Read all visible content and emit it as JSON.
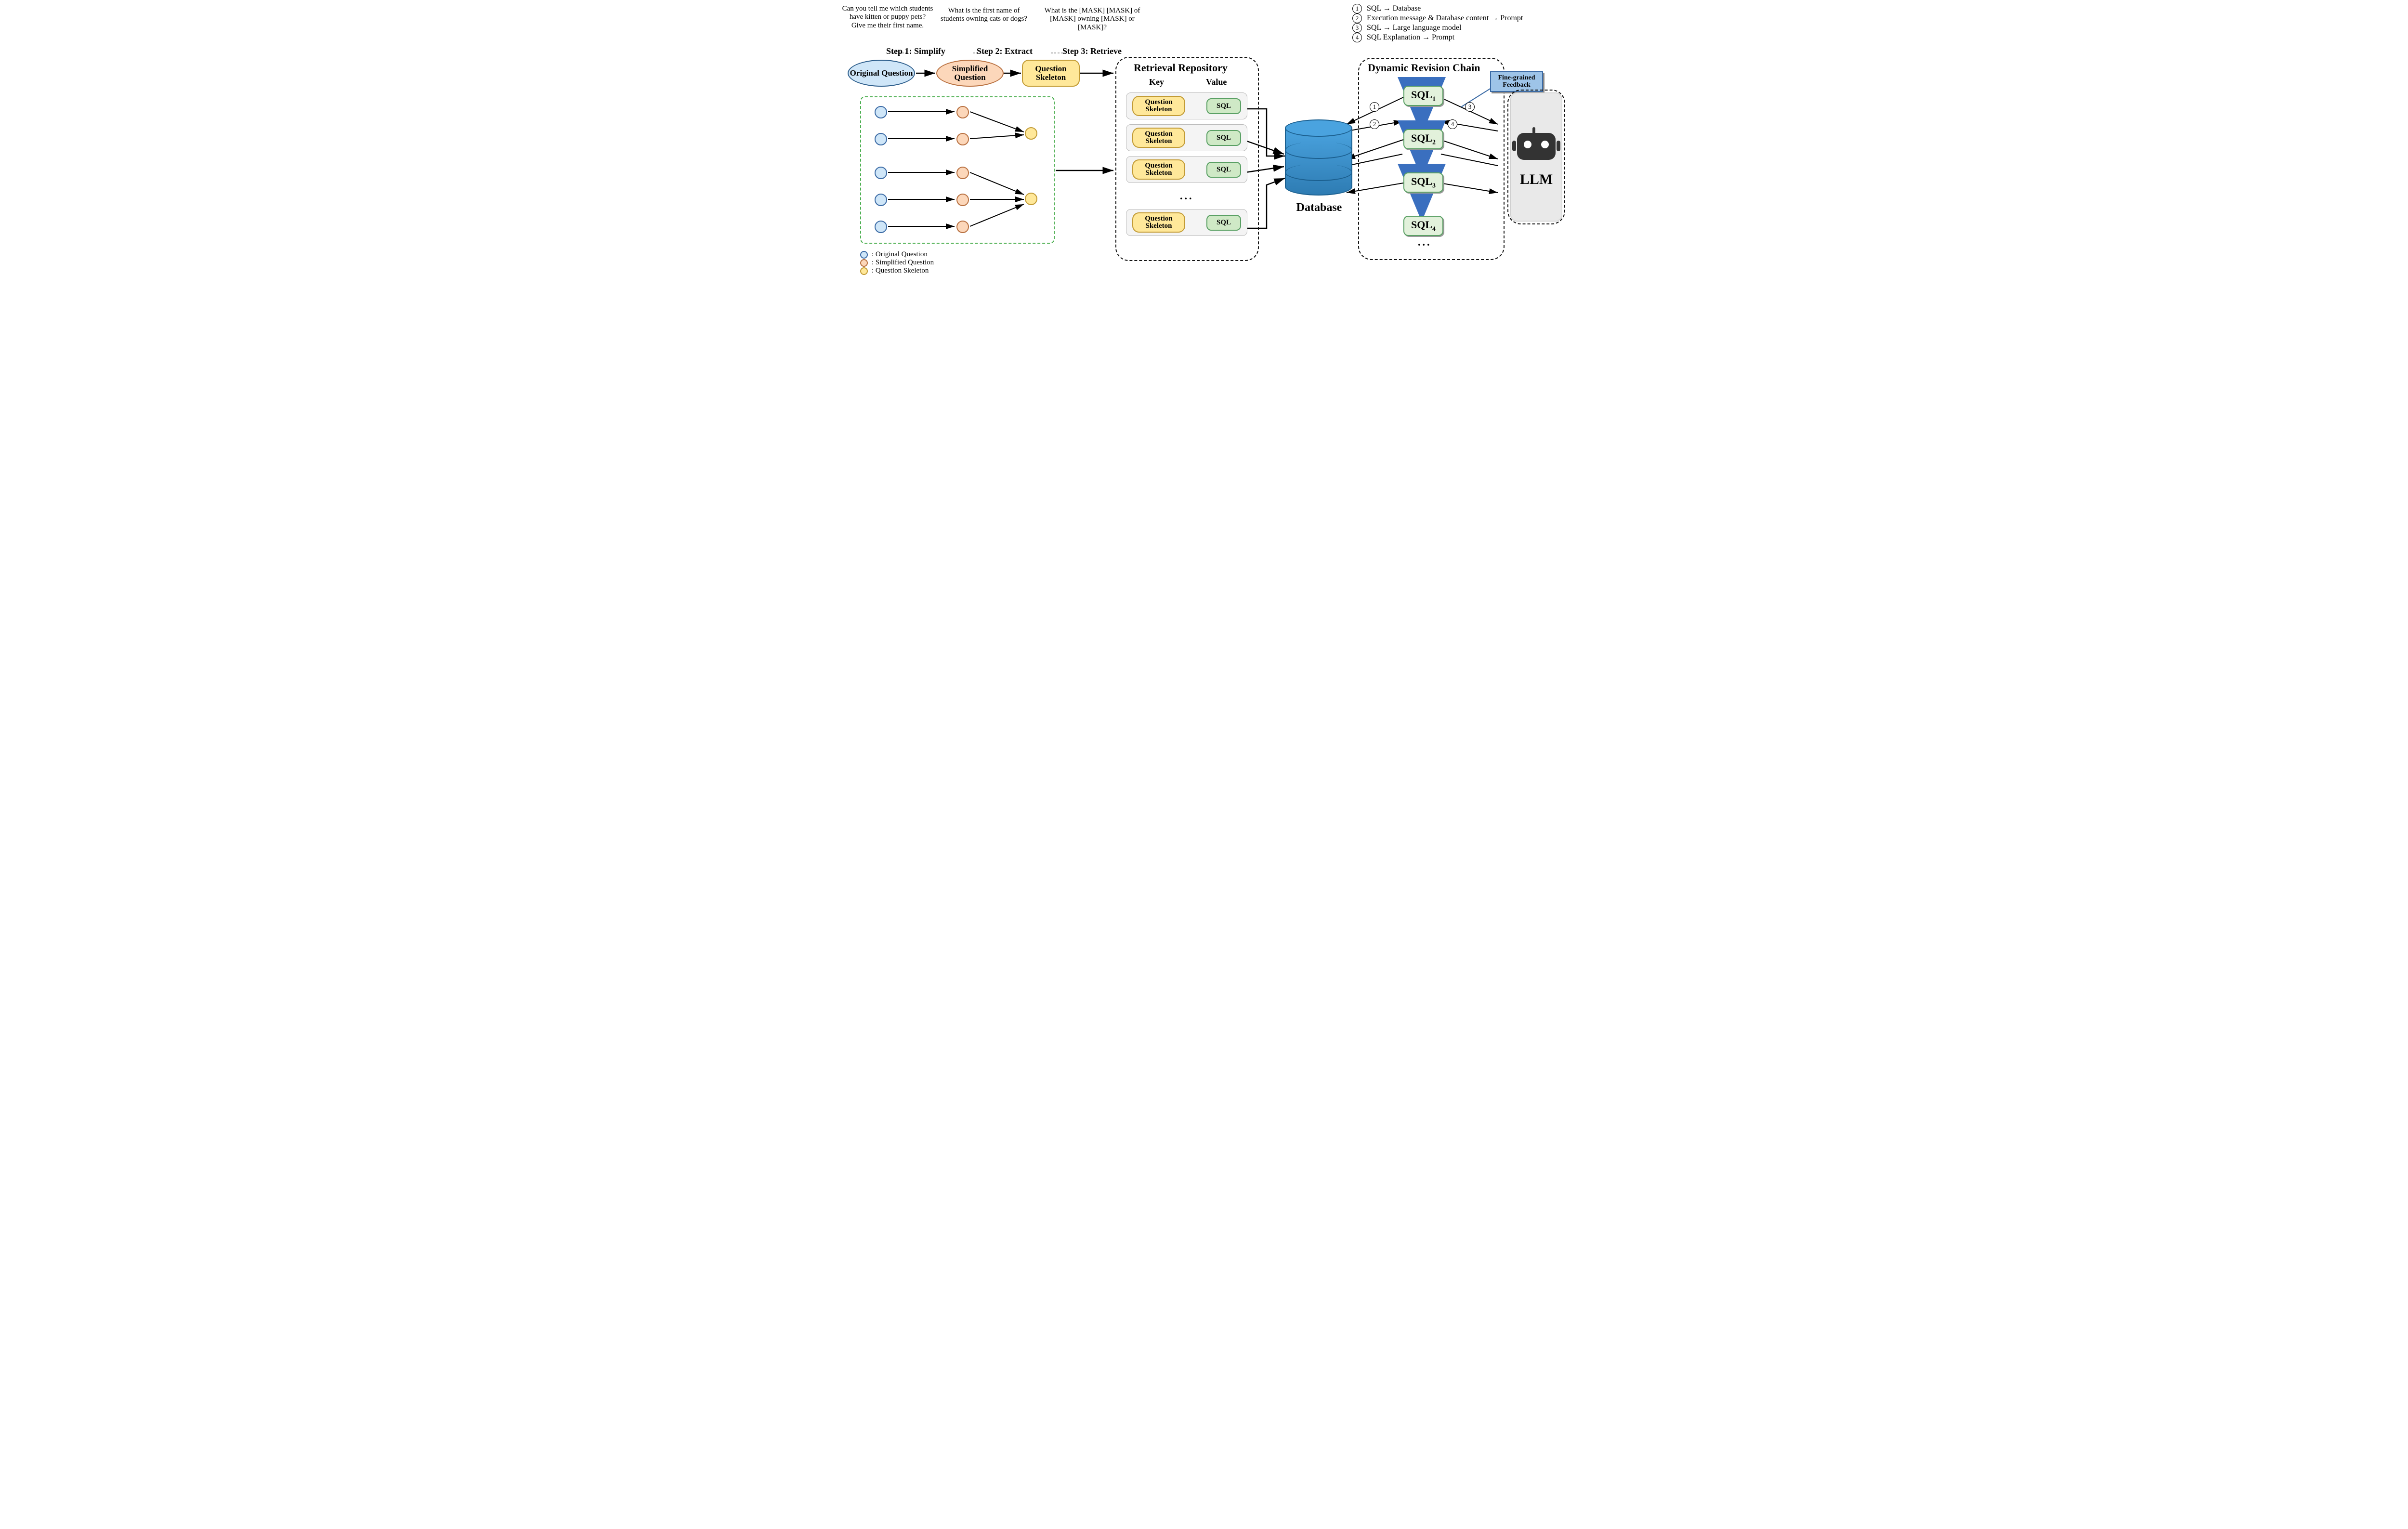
{
  "questions": {
    "original": "Can you tell me which students have kitten or puppy pets? Give me their first name.",
    "simplified": "What is the first name of students owning cats or dogs?",
    "skeleton": "What is the [MASK] [MASK] of [MASK] owning [MASK] or [MASK]?"
  },
  "steps": {
    "s1": "Step 1: Simplify",
    "s2": "Step 2: Extract",
    "s3": "Step 3: Retrieve"
  },
  "node_labels": {
    "original": "Original Question",
    "simplified": "Simplified Question",
    "skeleton": "Question Skeleton"
  },
  "legend": {
    "original": ": Original Question",
    "simplified": ": Simplified Question",
    "skeleton": ": Question Skeleton"
  },
  "repo": {
    "title": "Retrieval Repository",
    "key_header": "Key",
    "val_header": "Value",
    "key_label": "Question Skeleton",
    "val_label": "SQL",
    "ellipsis": "..."
  },
  "database_label": "Database",
  "chain": {
    "title": "Dynamic Revision Chain",
    "sql_labels": [
      "SQL",
      "SQL",
      "SQL",
      "SQL"
    ],
    "sql_subscripts": [
      "1",
      "2",
      "3",
      "4"
    ],
    "ellipsis": "...",
    "callout": "Fine-grained Feedback"
  },
  "llm_label": "LLM",
  "step_legend": [
    {
      "n": "1",
      "text": "SQL → Database"
    },
    {
      "n": "2",
      "text": "Execution message & Database content → Prompt"
    },
    {
      "n": "3",
      "text": "SQL → Large language model"
    },
    {
      "n": "4",
      "text": "SQL Explanation → Prompt"
    }
  ]
}
